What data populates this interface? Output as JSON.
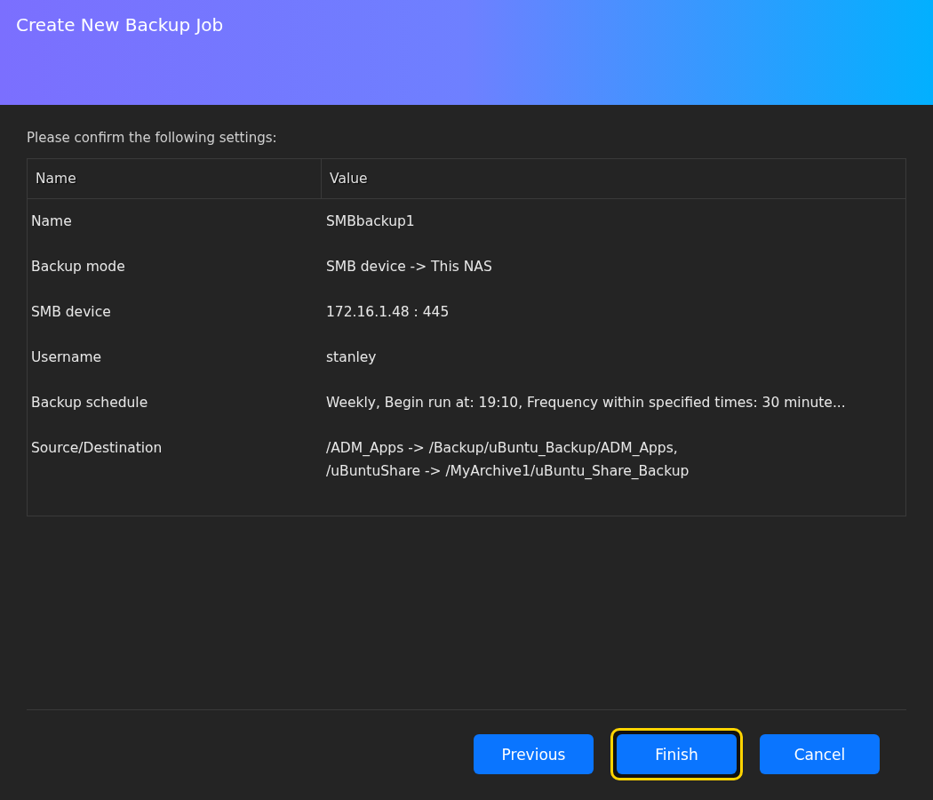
{
  "window": {
    "title": "Create New Backup Job"
  },
  "intro": "Please confirm the following settings:",
  "table": {
    "columns": [
      "Name",
      "Value"
    ],
    "rows": [
      {
        "name": "Name",
        "value": [
          "SMBbackup1"
        ]
      },
      {
        "name": "Backup mode",
        "value": [
          "SMB device -> This NAS"
        ]
      },
      {
        "name": "SMB device",
        "value": [
          "172.16.1.48 : 445"
        ]
      },
      {
        "name": "Username",
        "value": [
          "stanley"
        ]
      },
      {
        "name": "Backup schedule",
        "value": [
          "Weekly, Begin run at: 19:10, Frequency within specified times: 30 minute..."
        ]
      },
      {
        "name": "Source/Destination",
        "value": [
          "/ADM_Apps -> /Backup/uBuntu_Backup/ADM_Apps,",
          "/uBuntuShare -> /MyArchive1/uBuntu_Share_Backup"
        ]
      }
    ]
  },
  "buttons": [
    {
      "label": "Previous",
      "focused": false
    },
    {
      "label": "Finish",
      "focused": true
    },
    {
      "label": "Cancel",
      "focused": false
    }
  ]
}
